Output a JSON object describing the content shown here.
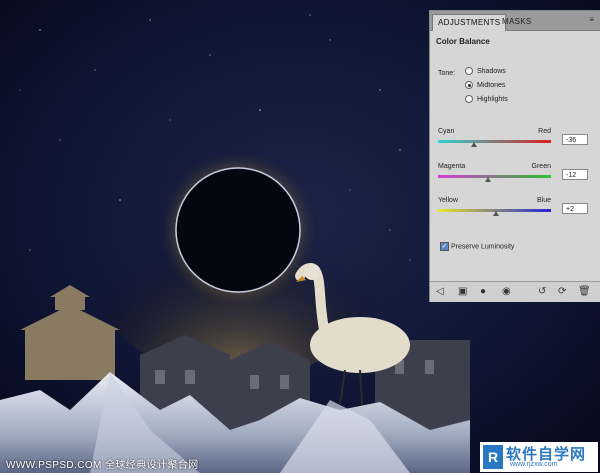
{
  "panel": {
    "tabs": [
      "ADJUSTMENTS",
      "MASKS"
    ],
    "menu_icon": "panel-menu-icon",
    "title": "Color Balance",
    "tone_label": "Tone:",
    "tones": [
      {
        "label": "Shadows",
        "selected": false
      },
      {
        "label": "Midtones",
        "selected": true
      },
      {
        "label": "Highlights",
        "selected": false
      }
    ],
    "sliders": [
      {
        "left": "Cyan",
        "right": "Red",
        "value": "-36",
        "level": 0.32,
        "from": "#2fd3d3",
        "to": "#d82020"
      },
      {
        "left": "Magenta",
        "right": "Green",
        "value": "-12",
        "level": 0.44,
        "from": "#d33ad3",
        "to": "#2fc02f"
      },
      {
        "left": "Yellow",
        "right": "Blue",
        "value": "+2",
        "level": 0.51,
        "from": "#e6e62a",
        "to": "#2424d8"
      }
    ],
    "preserve_luminosity": {
      "label": "Preserve Luminosity",
      "checked": true
    },
    "footer_icons": [
      "back-arrow-icon",
      "clip-layer-icon",
      "visibility-eye-icon",
      "view-previous-icon",
      "reset-icon",
      "delete-icon"
    ]
  },
  "watermark": {
    "left": "WWW.PSPSD.COM 全球经典设计聚合网",
    "right_top": "软件自学网",
    "right_bottom": "www.rjzxw.com",
    "logo_char": "R"
  },
  "colors": {
    "sky": "#0d1230",
    "eclipse_glow": "#d8a83a",
    "panel_bg": "#d6d6d6"
  }
}
